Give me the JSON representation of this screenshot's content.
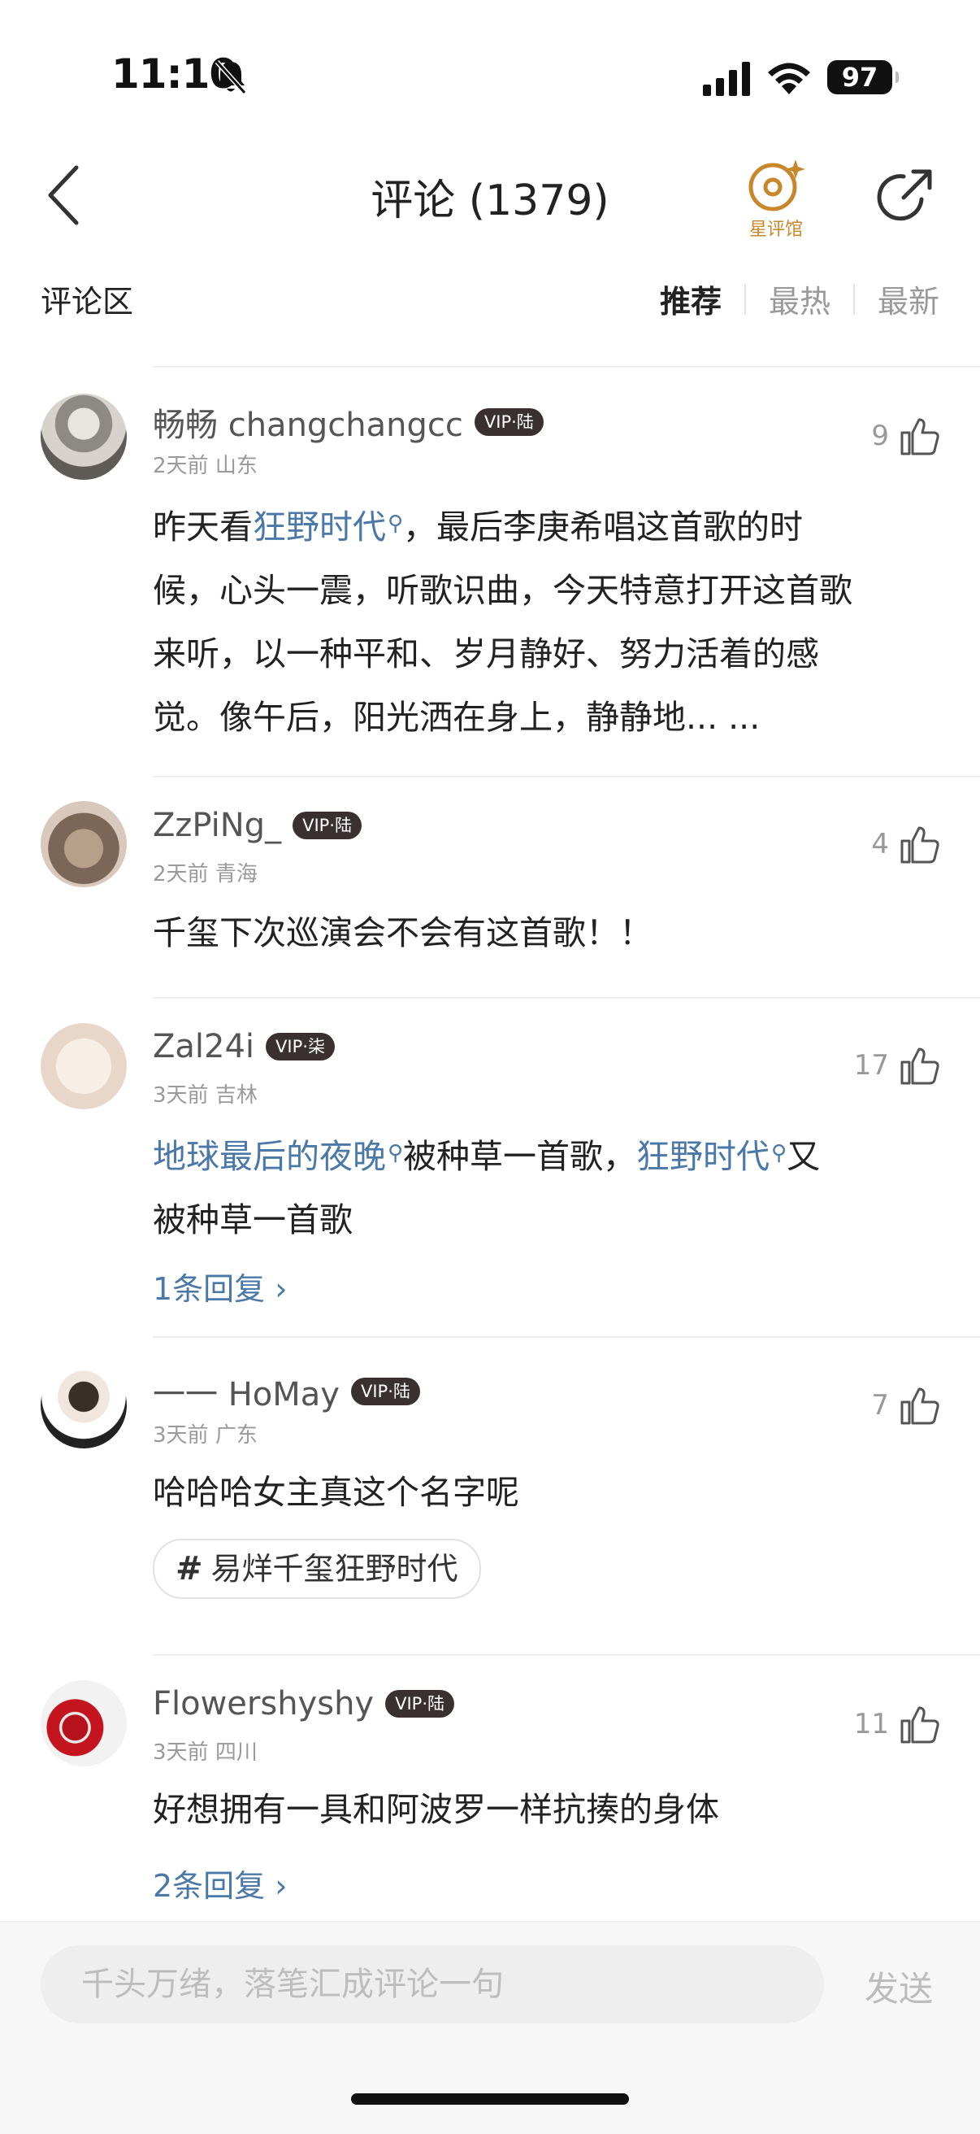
{
  "status_bar": {
    "time": "11:10",
    "battery": "97"
  },
  "header": {
    "title": "评论 (1379)",
    "star_pavilion_label": "星评馆"
  },
  "section": {
    "title": "评论区",
    "sort_tabs": [
      "推荐",
      "最热",
      "最新"
    ],
    "active_sort": "推荐"
  },
  "comments": [
    {
      "username": "畅畅 changchangcc",
      "vip_badge": "VIP·陆",
      "time": "2天前",
      "location": "山东",
      "likes": "9",
      "text_line1_pre": "昨天看",
      "text_line1_link": "狂野时代",
      "text_line1_post": "，最后李庚希唱这首歌的时",
      "text_line2": "候，心头一震，听歌识曲，今天特意打开这首歌",
      "text_line3": "来听，以一种平和、岁月静好、努力活着的感",
      "text_line4": "觉。像午后，阳光洒在身上，静静地... ..."
    },
    {
      "username": "ZzPiNg_",
      "vip_badge": "VIP·陆",
      "time": "2天前",
      "location": "青海",
      "likes": "4",
      "text": "千玺下次巡演会不会有这首歌！！"
    },
    {
      "username": "Zal24i",
      "vip_badge": "VIP·柒",
      "time": "3天前",
      "location": "吉林",
      "likes": "17",
      "link1": "地球最后的夜晚",
      "mid": "被种草一首歌，",
      "link2": "狂野时代",
      "end": "又",
      "text_line2": "被种草一首歌",
      "replies": "1条回复"
    },
    {
      "username": "一一 HoMay",
      "vip_badge": "VIP·陆",
      "time": "3天前",
      "location": "广东",
      "likes": "7",
      "text": "哈哈哈女主真这个名字呢",
      "topic": "易烊千玺狂野时代"
    },
    {
      "username": "Flowershyshy",
      "vip_badge": "VIP·陆",
      "time": "3天前",
      "location": "四川",
      "likes": "11",
      "text": "好想拥有一具和阿波罗一样抗揍的身体",
      "replies": "2条回复"
    }
  ],
  "composer": {
    "placeholder": "千头万绪，落笔汇成评论一句",
    "send_label": "发送"
  },
  "colors": {
    "link": "#4a78a8",
    "accent": "#c9872b",
    "vip_badge_bg": "#3a3030"
  }
}
